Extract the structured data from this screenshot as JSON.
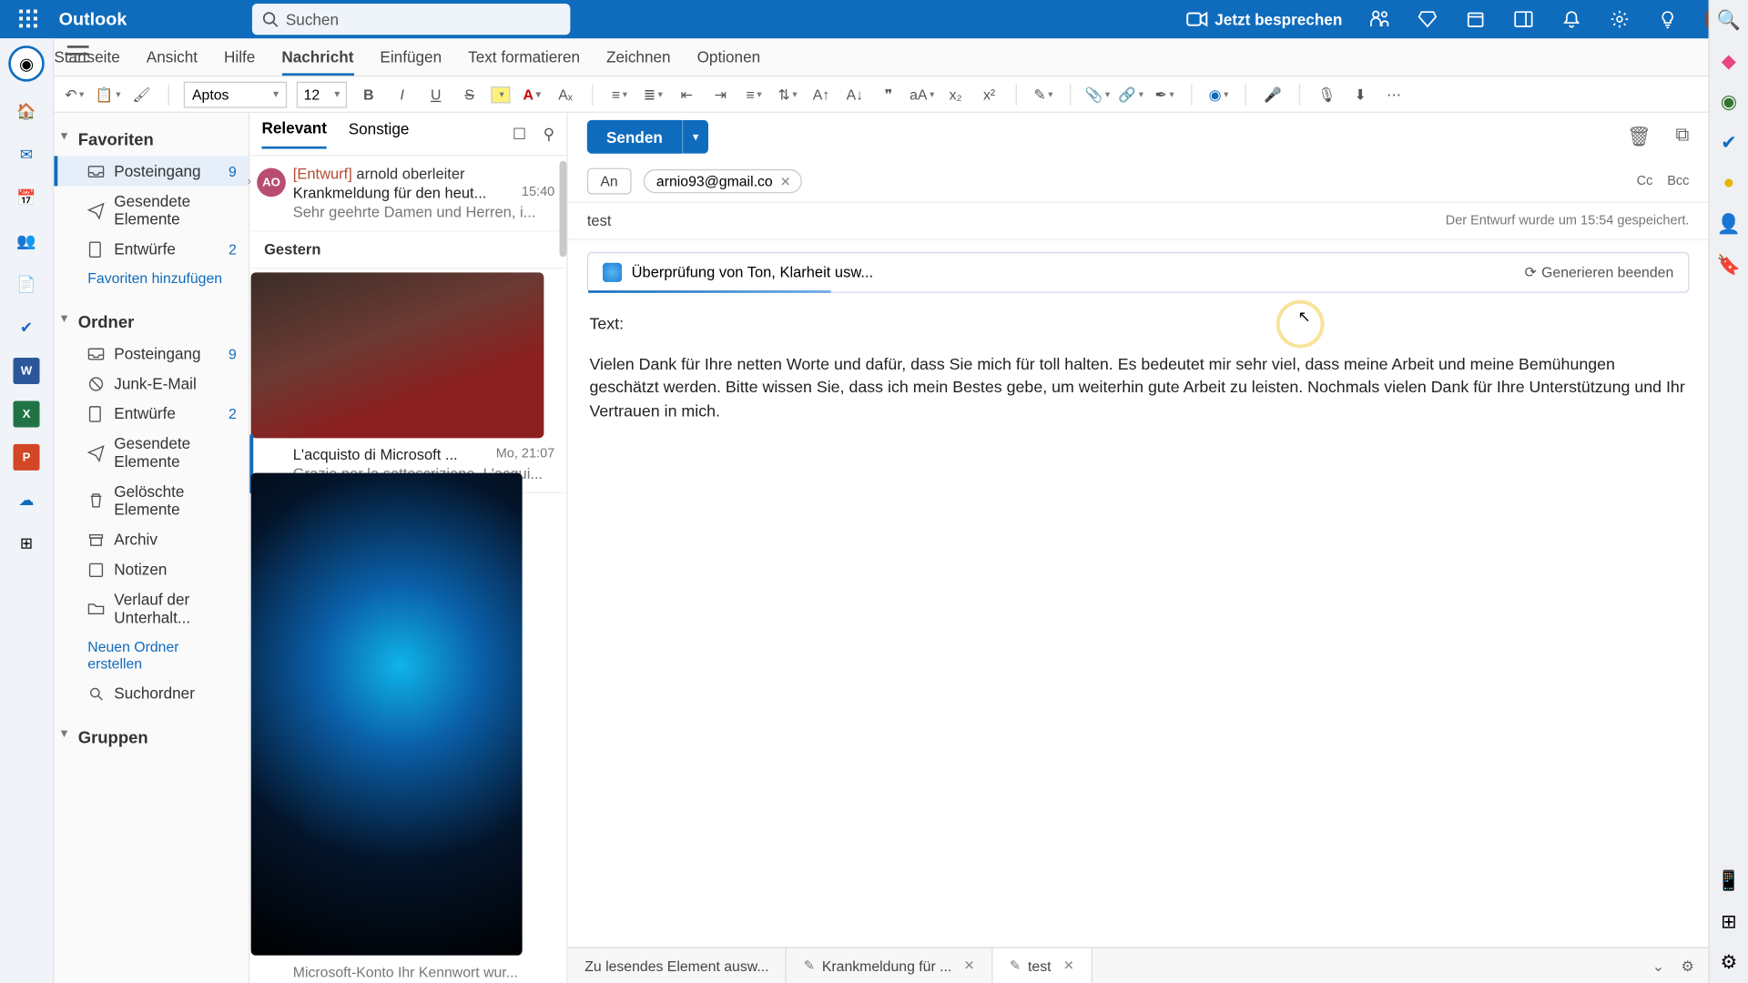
{
  "app": {
    "name": "Outlook"
  },
  "search": {
    "placeholder": "Suchen"
  },
  "header": {
    "meet_label": "Jetzt besprechen"
  },
  "menu_tabs": [
    "Startseite",
    "Ansicht",
    "Hilfe",
    "Nachricht",
    "Einfügen",
    "Text formatieren",
    "Zeichnen",
    "Optionen"
  ],
  "ribbon": {
    "font": "Aptos",
    "size": "12"
  },
  "nav": {
    "favorites": "Favoriten",
    "inbox": "Posteingang",
    "inbox_cnt": "9",
    "sent": "Gesendete Elemente",
    "drafts": "Entwürfe",
    "drafts_cnt": "2",
    "add_fav": "Favoriten hinzufügen",
    "folders": "Ordner",
    "inbox2": "Posteingang",
    "inbox2_cnt": "9",
    "junk": "Junk-E-Mail",
    "drafts2": "Entwürfe",
    "drafts2_cnt": "2",
    "sent2": "Gesendete Elemente",
    "deleted": "Gelöschte Elemente",
    "archive": "Archiv",
    "notes": "Notizen",
    "history": "Verlauf der Unterhalt...",
    "new_folder": "Neuen Ordner erstellen",
    "search_folders": "Suchordner",
    "groups": "Gruppen"
  },
  "inbox": {
    "tab_relevant": "Relevant",
    "tab_other": "Sonstige",
    "msg1": {
      "av": "AO",
      "tag": "[Entwurf]",
      "from": "arnold oberleiter",
      "subj": "Krankmeldung für den heut...",
      "time": "15:40",
      "preview": "Sehr geehrte Damen und Herren, i..."
    },
    "date1": "Gestern",
    "msg_hidden": {
      "subj": "L'acquisto di Microsoft ...",
      "time": "Mo, 21:07",
      "preview": "Grazie per la sottoscrizione. L'acqui..."
    },
    "bottom_preview": "Microsoft-Konto Ihr Kennwort wur..."
  },
  "compose": {
    "send": "Senden",
    "to_label": "An",
    "recipient": "arnio93@gmail.co",
    "cc": "Cc",
    "bcc": "Bcc",
    "subject": "test",
    "saved": "Der Entwurf wurde um 15:54 gespeichert.",
    "copilot_text": "Überprüfung von Ton, Klarheit usw...",
    "copilot_stop": "Generieren beenden",
    "body_label": "Text:",
    "body": "Vielen Dank für Ihre netten Worte und dafür, dass Sie mich für toll halten. Es bedeutet mir sehr viel, dass meine Arbeit und meine Bemühungen geschätzt werden. Bitte wissen Sie, dass ich mein Bestes gebe, um weiterhin gute Arbeit zu leisten. Nochmals vielen Dank für Ihre Unterstützung und Ihr Vertrauen in mich."
  },
  "bottom_tabs": {
    "t1": "Zu lesendes Element ausw...",
    "t2": "Krankmeldung für ...",
    "t3": "test"
  }
}
